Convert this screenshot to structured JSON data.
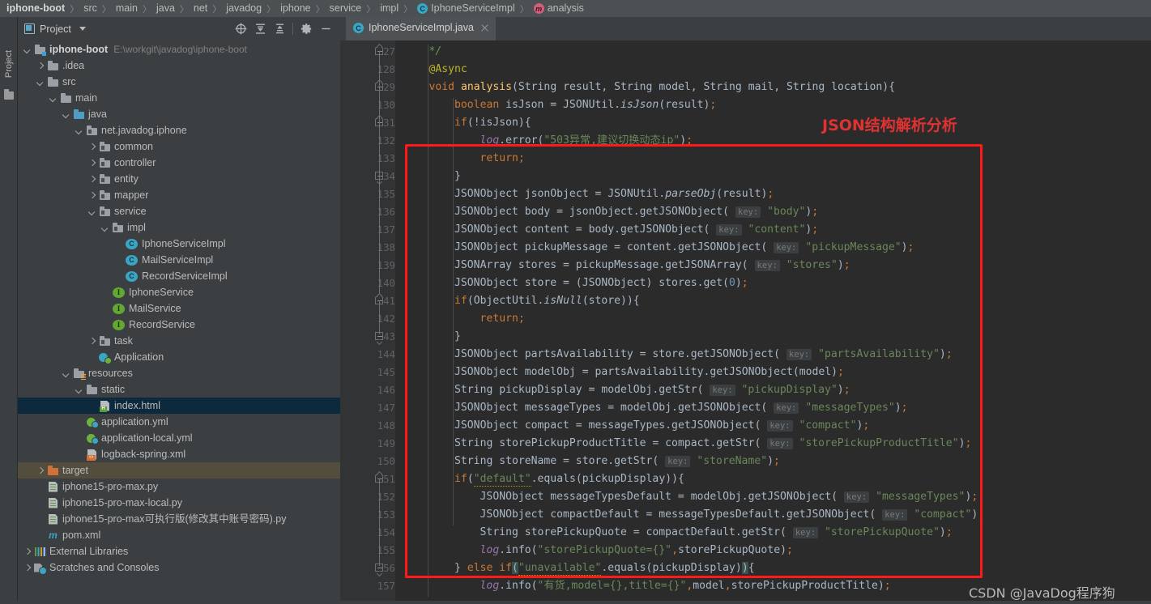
{
  "breadcrumb": [
    {
      "label": "iphone-boot",
      "bold": true,
      "icon": null
    },
    {
      "label": "src",
      "bold": false,
      "icon": null
    },
    {
      "label": "main",
      "bold": false,
      "icon": null
    },
    {
      "label": "java",
      "bold": false,
      "icon": null
    },
    {
      "label": "net",
      "bold": false,
      "icon": null
    },
    {
      "label": "javadog",
      "bold": false,
      "icon": null
    },
    {
      "label": "iphone",
      "bold": false,
      "icon": null
    },
    {
      "label": "service",
      "bold": false,
      "icon": null
    },
    {
      "label": "impl",
      "bold": false,
      "icon": null
    },
    {
      "label": "IphoneServiceImpl",
      "bold": false,
      "icon": "class-badge-icon",
      "badge": "C"
    },
    {
      "label": "analysis",
      "bold": false,
      "icon": "method-badge-icon",
      "badge": "m"
    }
  ],
  "left_toolbar": {
    "vertical_tab_label": "Project",
    "folder_icon": "folder-icon"
  },
  "project_panel": {
    "title": "Project",
    "title_icon": "project-view-icon",
    "dropdown_icon": "chevron-down-icon",
    "actions": [
      {
        "name": "select-opened-file-icon",
        "glyph": "crosshair"
      },
      {
        "name": "expand-all-icon",
        "glyph": "expand"
      },
      {
        "name": "collapse-all-icon",
        "glyph": "collapse"
      },
      {
        "name": "settings-gear-icon",
        "glyph": "gear"
      },
      {
        "name": "hide-panel-icon",
        "glyph": "minus"
      }
    ]
  },
  "tree": [
    {
      "indent": 0,
      "arrow": "down",
      "icon": "module-folder",
      "label": "iphone-boot",
      "bold": true,
      "path": "E:\\workgit\\javadog\\iphone-boot"
    },
    {
      "indent": 1,
      "arrow": "right",
      "icon": "folder",
      "label": ".idea"
    },
    {
      "indent": 1,
      "arrow": "down",
      "icon": "folder",
      "label": "src"
    },
    {
      "indent": 2,
      "arrow": "down",
      "icon": "folder",
      "label": "main"
    },
    {
      "indent": 3,
      "arrow": "down",
      "icon": "folder-blue",
      "label": "java"
    },
    {
      "indent": 4,
      "arrow": "down",
      "icon": "package",
      "label": "net.javadog.iphone"
    },
    {
      "indent": 5,
      "arrow": "right",
      "icon": "package",
      "label": "common"
    },
    {
      "indent": 5,
      "arrow": "right",
      "icon": "package",
      "label": "controller"
    },
    {
      "indent": 5,
      "arrow": "right",
      "icon": "package",
      "label": "entity"
    },
    {
      "indent": 5,
      "arrow": "right",
      "icon": "package",
      "label": "mapper"
    },
    {
      "indent": 5,
      "arrow": "down",
      "icon": "package",
      "label": "service"
    },
    {
      "indent": 6,
      "arrow": "down",
      "icon": "package",
      "label": "impl"
    },
    {
      "indent": 7,
      "arrow": "none",
      "icon": "class",
      "label": "IphoneServiceImpl"
    },
    {
      "indent": 7,
      "arrow": "none",
      "icon": "class",
      "label": "MailServiceImpl"
    },
    {
      "indent": 7,
      "arrow": "none",
      "icon": "class",
      "label": "RecordServiceImpl"
    },
    {
      "indent": 6,
      "arrow": "none",
      "icon": "interface",
      "label": "IphoneService"
    },
    {
      "indent": 6,
      "arrow": "none",
      "icon": "interface",
      "label": "MailService"
    },
    {
      "indent": 6,
      "arrow": "none",
      "icon": "interface",
      "label": "RecordService"
    },
    {
      "indent": 5,
      "arrow": "right",
      "icon": "package",
      "label": "task"
    },
    {
      "indent": 5,
      "arrow": "none",
      "icon": "spring-run",
      "label": "Application"
    },
    {
      "indent": 3,
      "arrow": "down",
      "icon": "resources-folder",
      "label": "resources"
    },
    {
      "indent": 4,
      "arrow": "down",
      "icon": "folder",
      "label": "static"
    },
    {
      "indent": 5,
      "arrow": "none",
      "icon": "html",
      "label": "index.html",
      "state": "selected"
    },
    {
      "indent": 4,
      "arrow": "none",
      "icon": "spring-yml",
      "label": "application.yml"
    },
    {
      "indent": 4,
      "arrow": "none",
      "icon": "spring-yml",
      "label": "application-local.yml"
    },
    {
      "indent": 4,
      "arrow": "none",
      "icon": "xml",
      "label": "logback-spring.xml"
    },
    {
      "indent": 1,
      "arrow": "right",
      "icon": "folder-orange",
      "label": "target",
      "state": "highlighted"
    },
    {
      "indent": 1,
      "arrow": "none",
      "icon": "python",
      "label": "iphone15-pro-max.py"
    },
    {
      "indent": 1,
      "arrow": "none",
      "icon": "python",
      "label": "iphone15-pro-max-local.py"
    },
    {
      "indent": 1,
      "arrow": "none",
      "icon": "python",
      "label": "iphone15-pro-max可执行版(修改其中账号密码).py"
    },
    {
      "indent": 1,
      "arrow": "none",
      "icon": "maven",
      "label": "pom.xml"
    },
    {
      "indent": 0,
      "arrow": "right",
      "icon": "external-libraries",
      "label": "External Libraries"
    },
    {
      "indent": 0,
      "arrow": "right",
      "icon": "scratches",
      "label": "Scratches and Consoles"
    }
  ],
  "editor": {
    "tab": {
      "label": "IphoneServiceImpl.java",
      "icon": "class-badge-icon",
      "badge": "C",
      "close_icon": "close-icon"
    },
    "first_line_number": 127,
    "lines": [
      {
        "n": 127,
        "indent": 1,
        "fold": "start",
        "tokens": [
          {
            "t": "*/",
            "c": "cmt"
          }
        ]
      },
      {
        "n": 128,
        "indent": 1,
        "tokens": [
          {
            "t": "@Async",
            "c": "ann"
          }
        ]
      },
      {
        "n": 129,
        "indent": 1,
        "fold": "start",
        "tokens": [
          {
            "t": "void ",
            "c": "kw"
          },
          {
            "t": "analysis",
            "c": "mth"
          },
          {
            "t": "(String result, String model, String mail, String location){",
            "c": "pln"
          }
        ]
      },
      {
        "n": 130,
        "indent": 2,
        "tokens": [
          {
            "t": "boolean",
            "c": "kw"
          },
          {
            "t": " isJson = JSONUtil.",
            "c": "pln"
          },
          {
            "t": "isJson",
            "c": "pln stat"
          },
          {
            "t": "(result)",
            "c": "pln"
          },
          {
            "t": ";",
            "c": "semi"
          }
        ]
      },
      {
        "n": 131,
        "indent": 2,
        "fold": "start",
        "tokens": [
          {
            "t": "if",
            "c": "kw"
          },
          {
            "t": "(!isJson){",
            "c": "pln"
          }
        ]
      },
      {
        "n": 132,
        "indent": 3,
        "tokens": [
          {
            "t": "log",
            "c": "fld stat"
          },
          {
            "t": ".error(",
            "c": "pln"
          },
          {
            "t": "\"503异常,建议切换动态ip\"",
            "c": "str"
          },
          {
            "t": ")",
            "c": "pln"
          },
          {
            "t": ";",
            "c": "semi"
          }
        ]
      },
      {
        "n": 133,
        "indent": 3,
        "tokens": [
          {
            "t": "return",
            "c": "kw"
          },
          {
            "t": ";",
            "c": "semi"
          }
        ]
      },
      {
        "n": 134,
        "indent": 2,
        "fold": "end",
        "tokens": [
          {
            "t": "}",
            "c": "pln"
          }
        ]
      },
      {
        "n": 135,
        "indent": 2,
        "tokens": [
          {
            "t": "JSONObject jsonObject = JSONUtil.",
            "c": "pln"
          },
          {
            "t": "parseObj",
            "c": "pln stat"
          },
          {
            "t": "(result)",
            "c": "pln"
          },
          {
            "t": ";",
            "c": "semi"
          }
        ]
      },
      {
        "n": 136,
        "indent": 2,
        "tokens": [
          {
            "t": "JSONObject body = jsonObject.getJSONObject( ",
            "c": "pln"
          },
          {
            "t": "key:",
            "c": "hint"
          },
          {
            "t": " ",
            "c": "pln"
          },
          {
            "t": "\"body\"",
            "c": "str"
          },
          {
            "t": ")",
            "c": "pln"
          },
          {
            "t": ";",
            "c": "semi"
          }
        ]
      },
      {
        "n": 137,
        "indent": 2,
        "tokens": [
          {
            "t": "JSONObject content = body.getJSONObject( ",
            "c": "pln"
          },
          {
            "t": "key:",
            "c": "hint"
          },
          {
            "t": " ",
            "c": "pln"
          },
          {
            "t": "\"content\"",
            "c": "str"
          },
          {
            "t": ")",
            "c": "pln"
          },
          {
            "t": ";",
            "c": "semi"
          }
        ]
      },
      {
        "n": 138,
        "indent": 2,
        "tokens": [
          {
            "t": "JSONObject pickupMessage = content.getJSONObject( ",
            "c": "pln"
          },
          {
            "t": "key:",
            "c": "hint"
          },
          {
            "t": " ",
            "c": "pln"
          },
          {
            "t": "\"pickupMessage\"",
            "c": "str"
          },
          {
            "t": ")",
            "c": "pln"
          },
          {
            "t": ";",
            "c": "semi"
          }
        ]
      },
      {
        "n": 139,
        "indent": 2,
        "tokens": [
          {
            "t": "JSONArray stores = pickupMessage.getJSONArray( ",
            "c": "pln"
          },
          {
            "t": "key:",
            "c": "hint"
          },
          {
            "t": " ",
            "c": "pln"
          },
          {
            "t": "\"stores\"",
            "c": "str"
          },
          {
            "t": ")",
            "c": "pln"
          },
          {
            "t": ";",
            "c": "semi"
          }
        ]
      },
      {
        "n": 140,
        "indent": 2,
        "tokens": [
          {
            "t": "JSONObject store = (JSONObject) stores.get(",
            "c": "pln"
          },
          {
            "t": "0",
            "c": "num"
          },
          {
            "t": ")",
            "c": "pln"
          },
          {
            "t": ";",
            "c": "semi"
          }
        ]
      },
      {
        "n": 141,
        "indent": 2,
        "fold": "start",
        "tokens": [
          {
            "t": "if",
            "c": "kw"
          },
          {
            "t": "(ObjectUtil.",
            "c": "pln"
          },
          {
            "t": "isNull",
            "c": "pln stat"
          },
          {
            "t": "(store)){",
            "c": "pln"
          }
        ]
      },
      {
        "n": 142,
        "indent": 3,
        "tokens": [
          {
            "t": "return",
            "c": "kw"
          },
          {
            "t": ";",
            "c": "semi"
          }
        ]
      },
      {
        "n": 143,
        "indent": 2,
        "fold": "end",
        "tokens": [
          {
            "t": "}",
            "c": "pln"
          }
        ]
      },
      {
        "n": 144,
        "indent": 2,
        "tokens": [
          {
            "t": "JSONObject partsAvailability = store.getJSONObject( ",
            "c": "pln"
          },
          {
            "t": "key:",
            "c": "hint"
          },
          {
            "t": " ",
            "c": "pln"
          },
          {
            "t": "\"partsAvailability\"",
            "c": "str"
          },
          {
            "t": ")",
            "c": "pln"
          },
          {
            "t": ";",
            "c": "semi"
          }
        ]
      },
      {
        "n": 145,
        "indent": 2,
        "tokens": [
          {
            "t": "JSONObject modelObj = partsAvailability.getJSONObject(model)",
            "c": "pln"
          },
          {
            "t": ";",
            "c": "semi"
          }
        ]
      },
      {
        "n": 146,
        "indent": 2,
        "tokens": [
          {
            "t": "String pickupDisplay = modelObj.getStr( ",
            "c": "pln"
          },
          {
            "t": "key:",
            "c": "hint"
          },
          {
            "t": " ",
            "c": "pln"
          },
          {
            "t": "\"pickupDisplay\"",
            "c": "str"
          },
          {
            "t": ")",
            "c": "pln"
          },
          {
            "t": ";",
            "c": "semi"
          }
        ]
      },
      {
        "n": 147,
        "indent": 2,
        "tokens": [
          {
            "t": "JSONObject messageTypes = modelObj.getJSONObject( ",
            "c": "pln"
          },
          {
            "t": "key:",
            "c": "hint"
          },
          {
            "t": " ",
            "c": "pln"
          },
          {
            "t": "\"messageTypes\"",
            "c": "str"
          },
          {
            "t": ")",
            "c": "pln"
          },
          {
            "t": ";",
            "c": "semi"
          }
        ]
      },
      {
        "n": 148,
        "indent": 2,
        "tokens": [
          {
            "t": "JSONObject compact = messageTypes.getJSONObject( ",
            "c": "pln"
          },
          {
            "t": "key:",
            "c": "hint"
          },
          {
            "t": " ",
            "c": "pln"
          },
          {
            "t": "\"compact\"",
            "c": "str"
          },
          {
            "t": ")",
            "c": "pln"
          },
          {
            "t": ";",
            "c": "semi"
          }
        ]
      },
      {
        "n": 149,
        "indent": 2,
        "tokens": [
          {
            "t": "String storePickupProductTitle = compact.getStr( ",
            "c": "pln"
          },
          {
            "t": "key:",
            "c": "hint"
          },
          {
            "t": " ",
            "c": "pln"
          },
          {
            "t": "\"storePickupProductTitle\"",
            "c": "str"
          },
          {
            "t": ")",
            "c": "pln"
          },
          {
            "t": ";",
            "c": "semi"
          }
        ]
      },
      {
        "n": 150,
        "indent": 2,
        "tokens": [
          {
            "t": "String storeName = store.getStr( ",
            "c": "pln"
          },
          {
            "t": "key:",
            "c": "hint"
          },
          {
            "t": " ",
            "c": "pln"
          },
          {
            "t": "\"storeName\"",
            "c": "str"
          },
          {
            "t": ")",
            "c": "pln"
          },
          {
            "t": ";",
            "c": "semi"
          }
        ]
      },
      {
        "n": 151,
        "indent": 2,
        "fold": "start",
        "tokens": [
          {
            "t": "if",
            "c": "kw"
          },
          {
            "t": "(",
            "c": "pln"
          },
          {
            "t": "\"default\"",
            "c": "str warn"
          },
          {
            "t": ".equals(pickupDisplay)){",
            "c": "pln"
          }
        ]
      },
      {
        "n": 152,
        "indent": 3,
        "tokens": [
          {
            "t": "JSONObject messageTypesDefault = modelObj.getJSONObject( ",
            "c": "pln"
          },
          {
            "t": "key:",
            "c": "hint"
          },
          {
            "t": " ",
            "c": "pln"
          },
          {
            "t": "\"messageTypes\"",
            "c": "str"
          },
          {
            "t": ")",
            "c": "pln"
          },
          {
            "t": ";",
            "c": "semi"
          }
        ]
      },
      {
        "n": 153,
        "indent": 3,
        "tokens": [
          {
            "t": "JSONObject compactDefault = messageTypesDefault.getJSONObject( ",
            "c": "pln"
          },
          {
            "t": "key:",
            "c": "hint"
          },
          {
            "t": " ",
            "c": "pln"
          },
          {
            "t": "\"compact\"",
            "c": "str"
          },
          {
            "t": ")",
            "c": "pln"
          },
          {
            "t": ";",
            "c": "semi"
          }
        ]
      },
      {
        "n": 154,
        "indent": 3,
        "tokens": [
          {
            "t": "String storePickupQuote = compactDefault.getStr( ",
            "c": "pln"
          },
          {
            "t": "key:",
            "c": "hint"
          },
          {
            "t": " ",
            "c": "pln"
          },
          {
            "t": "\"storePickupQuote\"",
            "c": "str"
          },
          {
            "t": ")",
            "c": "pln"
          },
          {
            "t": ";",
            "c": "semi"
          }
        ]
      },
      {
        "n": 155,
        "indent": 3,
        "tokens": [
          {
            "t": "log",
            "c": "fld stat"
          },
          {
            "t": ".info(",
            "c": "pln"
          },
          {
            "t": "\"storePickupQuote={}\"",
            "c": "str"
          },
          {
            "t": ",",
            "c": "semi"
          },
          {
            "t": "storePickupQuote)",
            "c": "pln"
          },
          {
            "t": ";",
            "c": "semi"
          }
        ]
      },
      {
        "n": 156,
        "indent": 2,
        "fold": "end",
        "tokens": [
          {
            "t": "} ",
            "c": "pln"
          },
          {
            "t": "else if",
            "c": "kw"
          },
          {
            "t": "(",
            "c": "pln brmatch"
          },
          {
            "t": "\"unavailable\"",
            "c": "str warn"
          },
          {
            "t": ".equals(pickupDisplay)",
            "c": "pln"
          },
          {
            "t": ")",
            "c": "pln brmatch"
          },
          {
            "t": "{",
            "c": "pln"
          }
        ]
      },
      {
        "n": 157,
        "indent": 3,
        "tokens": [
          {
            "t": "log",
            "c": "fld stat"
          },
          {
            "t": ".info(",
            "c": "pln"
          },
          {
            "t": "\"有货,model={},title={}\"",
            "c": "str"
          },
          {
            "t": ",",
            "c": "semi"
          },
          {
            "t": "model",
            "c": "pln"
          },
          {
            "t": ",",
            "c": "semi"
          },
          {
            "t": "storePickupProductTitle)",
            "c": "pln"
          },
          {
            "t": ";",
            "c": "semi"
          }
        ]
      }
    ]
  },
  "annotations": {
    "callout_text": "JSON结构解析分析",
    "callout_color": "#e03232",
    "box_color": "#ff1a1a",
    "watermark": "CSDN @JavaDog程序狗"
  }
}
